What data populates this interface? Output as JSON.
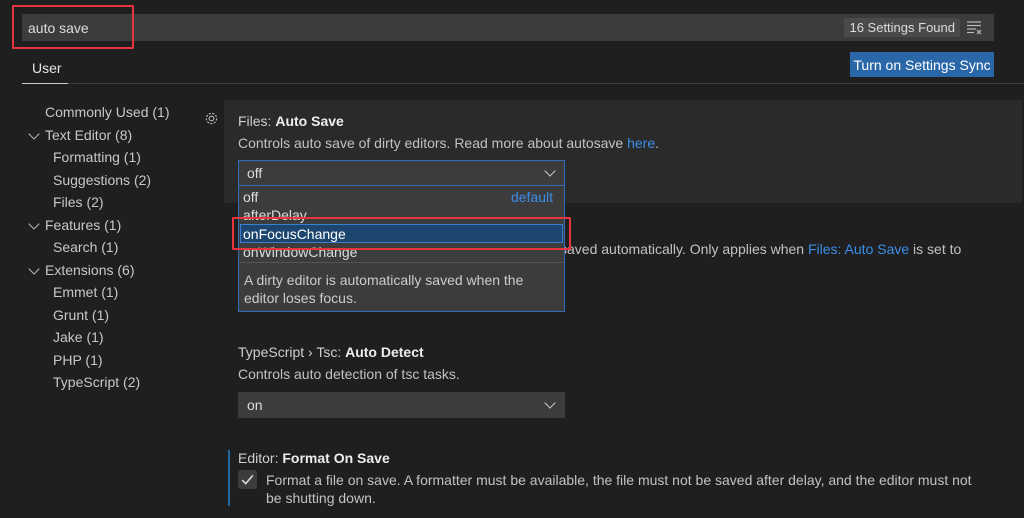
{
  "search": {
    "value": "auto save",
    "results_badge": "16 Settings Found",
    "clear_icon": "clear-filter-icon"
  },
  "tabs": [
    {
      "label": "User",
      "active": true
    }
  ],
  "sync_button": "Turn on Settings Sync",
  "tree": [
    {
      "label": "Commonly Used (1)",
      "level": 0,
      "expandable": false
    },
    {
      "label": "Text Editor (8)",
      "level": 0,
      "expandable": true
    },
    {
      "label": "Formatting (1)",
      "level": 1
    },
    {
      "label": "Suggestions (2)",
      "level": 1
    },
    {
      "label": "Files (2)",
      "level": 1
    },
    {
      "label": "Features (1)",
      "level": 0,
      "expandable": true
    },
    {
      "label": "Search (1)",
      "level": 1
    },
    {
      "label": "Extensions (6)",
      "level": 0,
      "expandable": true
    },
    {
      "label": "Emmet (1)",
      "level": 1
    },
    {
      "label": "Grunt (1)",
      "level": 1
    },
    {
      "label": "Jake (1)",
      "level": 1
    },
    {
      "label": "PHP (1)",
      "level": 1
    },
    {
      "label": "TypeScript (2)",
      "level": 1
    }
  ],
  "settings": {
    "auto_save": {
      "category": "Files: ",
      "name": "Auto Save",
      "desc": "Controls auto save of dirty editors. Read more about autosave ",
      "desc_link": "here",
      "desc_end": ".",
      "value": "off",
      "options": [
        "off",
        "afterDelay",
        "onFocusChange",
        "onWindowChange"
      ],
      "default_label": "default",
      "highlighted": "onFocusChange",
      "option_desc": "A dirty editor is automatically saved when the editor loses focus."
    },
    "auto_save_delay": {
      "desc_visible": "saved automatically. Only applies when ",
      "desc_link": "Files: Auto Save",
      "desc_end": " is set to"
    },
    "tsc": {
      "category": "TypeScript › Tsc: ",
      "name": "Auto Detect",
      "desc": "Controls auto detection of tsc tasks.",
      "value": "on"
    },
    "format_on_save": {
      "category": "Editor: ",
      "name": "Format On Save",
      "checked": true,
      "desc": "Format a file on save. A formatter must be available, the file must not be saved after delay, and the editor must not be shutting down."
    }
  },
  "colors": {
    "accent": "#2a67a8",
    "highlight": "#e8343f",
    "link": "#3b8eea"
  }
}
